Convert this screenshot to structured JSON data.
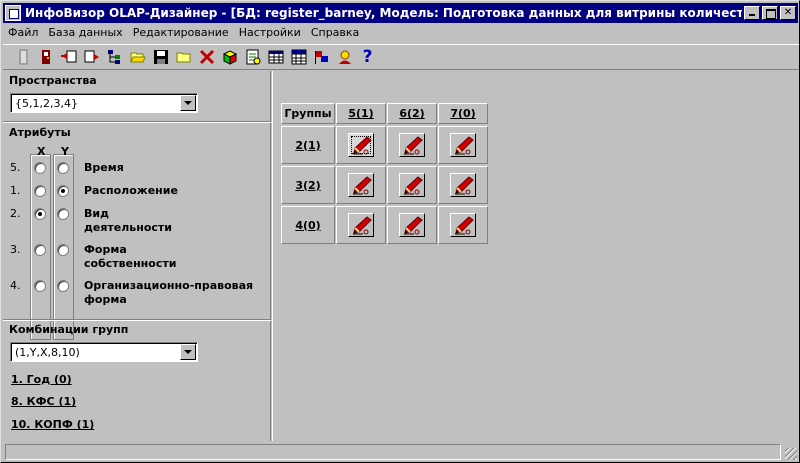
{
  "title": "ИнфоВизор OLAP-Дизайнер - [БД: register_barney, Модель: Подготовка данных для витрины количества, Файл: C:\\IV...",
  "menu": [
    "Файл",
    "База данных",
    "Редактирование",
    "Настройки",
    "Справка"
  ],
  "toolbar_icons": [
    "door-icon",
    "exit-icon",
    "import-icon",
    "export-icon",
    "tree-icon",
    "open-folder-icon",
    "save-icon",
    "folder-icon",
    "delete-icon",
    "cube-icon",
    "report-icon",
    "table-icon",
    "grid-icon",
    "flags-icon",
    "wizard-icon",
    "help-icon"
  ],
  "spaces": {
    "label": "Пространства",
    "value": "{5,1,2,3,4}"
  },
  "attributes": {
    "label": "Атрибуты",
    "x_label": "X",
    "y_label": "Y",
    "items": [
      {
        "num": "5.",
        "name": "Время",
        "x": false,
        "y": false
      },
      {
        "num": "1.",
        "name": "Расположение",
        "x": false,
        "y": true
      },
      {
        "num": "2.",
        "name": "Вид деятельности",
        "x": true,
        "y": false
      },
      {
        "num": "3.",
        "name": "Форма собственности",
        "x": false,
        "y": false
      },
      {
        "num": "4.",
        "name": "Организационно-правовая форма",
        "x": false,
        "y": false
      }
    ]
  },
  "combos": {
    "label": "Комбинации групп",
    "value": "(1,Y,X,8,10)",
    "links": [
      "1. Год (0)",
      "8. КФС (1)",
      "10. КОПФ (1)"
    ]
  },
  "grid": {
    "corner": "Группы",
    "columns": [
      "5(1)",
      "6(2)",
      "7(0)"
    ],
    "rows": [
      "2(1)",
      "3(2)",
      "4(0)"
    ]
  }
}
